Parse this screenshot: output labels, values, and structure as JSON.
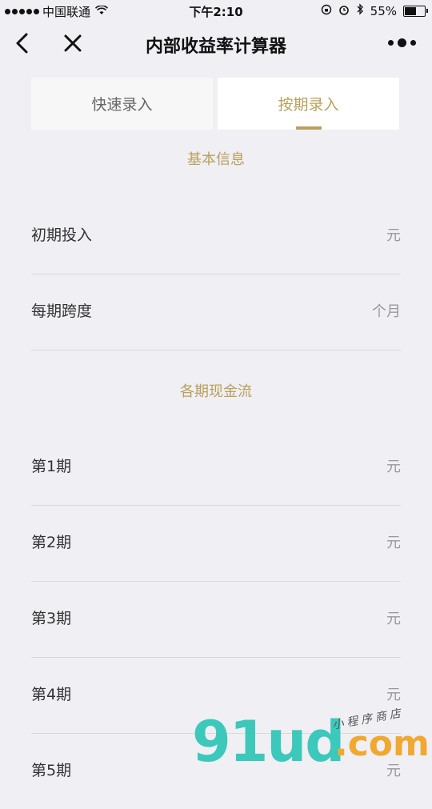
{
  "status_bar": {
    "carrier": "中国联通",
    "time": "下午2:10",
    "battery": "55%"
  },
  "nav": {
    "title": "内部收益率计算器"
  },
  "tabs": [
    {
      "label": "快速录入",
      "active": false
    },
    {
      "label": "按期录入",
      "active": true
    }
  ],
  "sections": {
    "basic": "基本信息",
    "cashflow": "各期现金流"
  },
  "basic_rows": [
    {
      "label": "初期投入",
      "unit": "元"
    },
    {
      "label": "每期跨度",
      "unit": "个月"
    }
  ],
  "period_rows": [
    {
      "label": "第1期",
      "unit": "元"
    },
    {
      "label": "第2期",
      "unit": "元"
    },
    {
      "label": "第3期",
      "unit": "元"
    },
    {
      "label": "第4期",
      "unit": "元"
    },
    {
      "label": "第5期",
      "unit": "元"
    }
  ],
  "watermark": {
    "main": "91ud",
    "suffix": ".com",
    "tagline": "小程序商店"
  },
  "colors": {
    "accent": "#b9a15c",
    "background": "#efeff4"
  }
}
